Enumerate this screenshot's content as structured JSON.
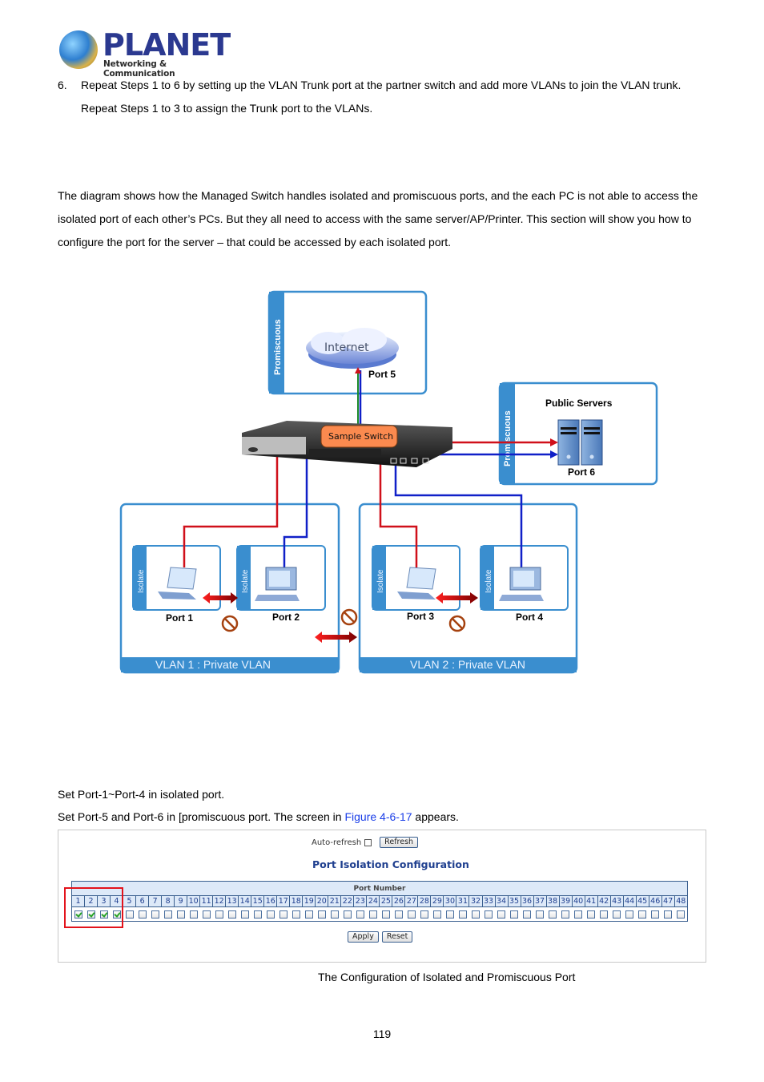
{
  "header": {
    "logo_name": "PLANET",
    "logo_tagline": "Networking & Communication"
  },
  "steps": {
    "number": "6.",
    "line1": "Repeat Steps 1 to 6 by setting up the VLAN Trunk port at the partner switch and add more VLANs to join the VLAN trunk.",
    "line2": "Repeat Steps 1 to 3 to assign the Trunk port to the VLANs."
  },
  "intro": "The diagram shows how the Managed Switch handles isolated and promiscuous ports, and the each PC is not able to access the isolated port of each other’s PCs. But they all need to access with the same server/AP/Printer. This section will show you how to configure the port for the server – that could be accessed by each isolated port.",
  "diagram": {
    "internet_label": "Internet",
    "promiscuous_label": "Promiscuous",
    "port5": "Port 5",
    "switch_label": "Sample Switch",
    "servers_title": "Public Servers",
    "port6": "Port 6",
    "isolate_label": "Isolate",
    "port1": "Port 1",
    "port2": "Port 2",
    "port3": "Port 3",
    "port4": "Port 4",
    "vlan1": "VLAN 1 : Private VLAN",
    "vlan2": "VLAN 2 : Private VLAN",
    "colors": {
      "red_link": "#d0101a",
      "blue_link": "#1020c8",
      "panel_blue": "#3a8ecf",
      "callout": "#fb8a4f"
    }
  },
  "instructions": {
    "line1": "Set Port-1~Port-4 in isolated port.",
    "line2_before": "Set Port-5 and Port-6 in [promiscuous port. The screen in ",
    "line2_link": "Figure 4-6-17",
    "line2_after": " appears."
  },
  "config": {
    "auto_refresh_label": "Auto-refresh",
    "auto_refresh_checked": false,
    "refresh_button": "Refresh",
    "title": "Port Isolation Configuration",
    "port_number_header": "Port Number",
    "ports": [
      "1",
      "2",
      "3",
      "4",
      "5",
      "6",
      "7",
      "8",
      "9",
      "10",
      "11",
      "12",
      "13",
      "14",
      "15",
      "16",
      "17",
      "18",
      "19",
      "20",
      "21",
      "22",
      "23",
      "24",
      "25",
      "26",
      "27",
      "28",
      "29",
      "30",
      "31",
      "32",
      "33",
      "34",
      "35",
      "36",
      "37",
      "38",
      "39",
      "40",
      "41",
      "42",
      "43",
      "44",
      "45",
      "46",
      "47",
      "48"
    ],
    "checked_ports": [
      "1",
      "2",
      "3",
      "4"
    ],
    "apply_button": "Apply",
    "reset_button": "Reset"
  },
  "caption": "The Configuration of Isolated and Promiscuous Port",
  "page_number": "119"
}
